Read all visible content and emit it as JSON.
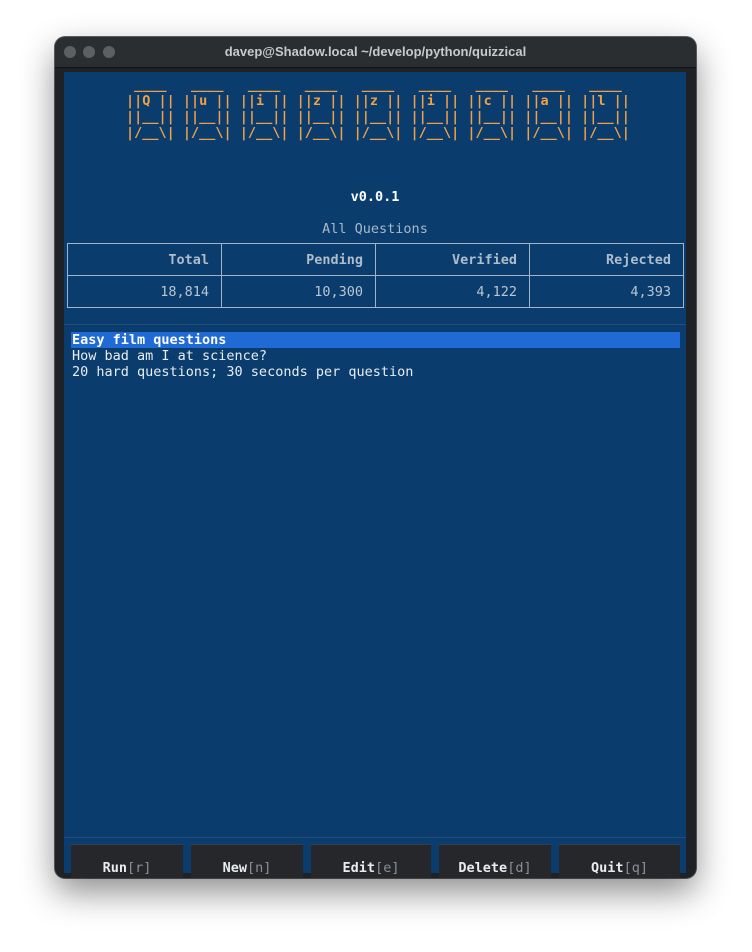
{
  "window": {
    "title": "davep@Shadow.local ~/develop/python/quizzical"
  },
  "app": {
    "logo": " ____   ____   ____   ____   ____   ____   ____   ____   ____\n||Q || ||u || ||i || ||z || ||z || ||i || ||c || ||a || ||l ||\n||__|| ||__|| ||__|| ||__|| ||__|| ||__|| ||__|| ||__|| ||__||\n|/__\\| |/__\\| |/__\\| |/__\\| |/__\\| |/__\\| |/__\\| |/__\\| |/__\\|",
    "version": "v0.0.1",
    "stats_title": "All Questions"
  },
  "stats": {
    "headers": [
      "Total",
      "Pending",
      "Verified",
      "Rejected"
    ],
    "values": [
      "18,814",
      "10,300",
      "4,122",
      "4,393"
    ]
  },
  "quizzes": {
    "items": [
      "Easy film questions",
      "How bad am I at science?",
      "20 hard questions; 30 seconds per question"
    ],
    "selected_index": 0
  },
  "buttons": [
    {
      "label": "Run",
      "key": "[r]"
    },
    {
      "label": "New",
      "key": "[n]"
    },
    {
      "label": "Edit",
      "key": "[e]"
    },
    {
      "label": "Delete",
      "key": "[d]"
    },
    {
      "label": "Quit",
      "key": "[q]"
    }
  ]
}
